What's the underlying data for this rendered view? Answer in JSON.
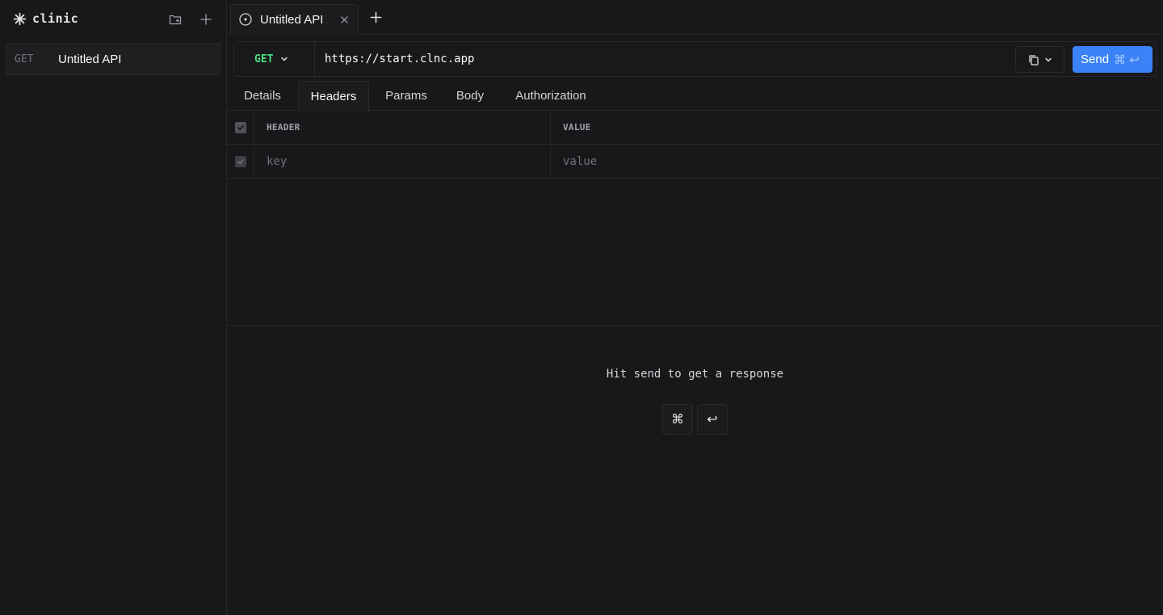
{
  "app": {
    "name": "clinic"
  },
  "sidebar": {
    "icons": {
      "new_folder": "folder-plus-icon",
      "add": "plus-icon"
    },
    "items": [
      {
        "method": "GET",
        "name": "Untitled API"
      }
    ]
  },
  "tabs": [
    {
      "label": "Untitled API",
      "icon": "circle-dot-icon",
      "close": "×"
    }
  ],
  "request": {
    "method": "GET",
    "url": "https://start.clnc.app",
    "send_label": "Send",
    "send_shortcut": "⌘ ↩",
    "method_color": "#4ade80",
    "accent": "#3b82f6"
  },
  "request_tabs": [
    {
      "label": "Details",
      "active": false
    },
    {
      "label": "Headers",
      "active": true
    },
    {
      "label": "Params",
      "active": false
    },
    {
      "label": "Body",
      "active": false
    },
    {
      "label": "Authorization",
      "active": false
    }
  ],
  "headers_table": {
    "columns": {
      "header": "HEADER",
      "value": "VALUE"
    },
    "rows": [
      {
        "key_placeholder": "key",
        "value_placeholder": "value",
        "enabled": true
      }
    ]
  },
  "response": {
    "empty_message": "Hit send to get a response",
    "keys": [
      "⌘",
      "↩"
    ]
  }
}
